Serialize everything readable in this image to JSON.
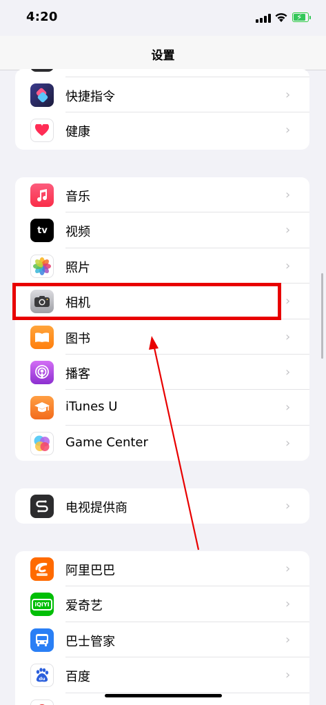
{
  "status": {
    "time": "4:20"
  },
  "nav": {
    "title": "设置"
  },
  "group1": [
    {
      "label": "快捷指令",
      "icon": "shortcuts-icon"
    },
    {
      "label": "健康",
      "icon": "health-icon"
    }
  ],
  "group2": [
    {
      "label": "音乐",
      "icon": "music-icon"
    },
    {
      "label": "视频",
      "icon": "tv-icon",
      "icon_text": "tv"
    },
    {
      "label": "照片",
      "icon": "photos-icon"
    },
    {
      "label": "相机",
      "icon": "camera-icon"
    },
    {
      "label": "图书",
      "icon": "books-icon"
    },
    {
      "label": "播客",
      "icon": "podcasts-icon"
    },
    {
      "label": "iTunes U",
      "icon": "itunes-u-icon"
    },
    {
      "label": "Game Center",
      "icon": "game-center-icon"
    }
  ],
  "group3": [
    {
      "label": "电视提供商",
      "icon": "tv-provider-icon"
    }
  ],
  "group4": [
    {
      "label": "阿里巴巴",
      "icon": "alibaba-icon"
    },
    {
      "label": "爱奇艺",
      "icon": "iqiyi-icon",
      "icon_text": "iQIYI"
    },
    {
      "label": "巴士管家",
      "icon": "bus-icon"
    },
    {
      "label": "百度",
      "icon": "baidu-icon",
      "icon_text": "du"
    }
  ],
  "chevron": "›",
  "colors": {
    "highlight": "#e80000",
    "accent": "#34c759"
  }
}
